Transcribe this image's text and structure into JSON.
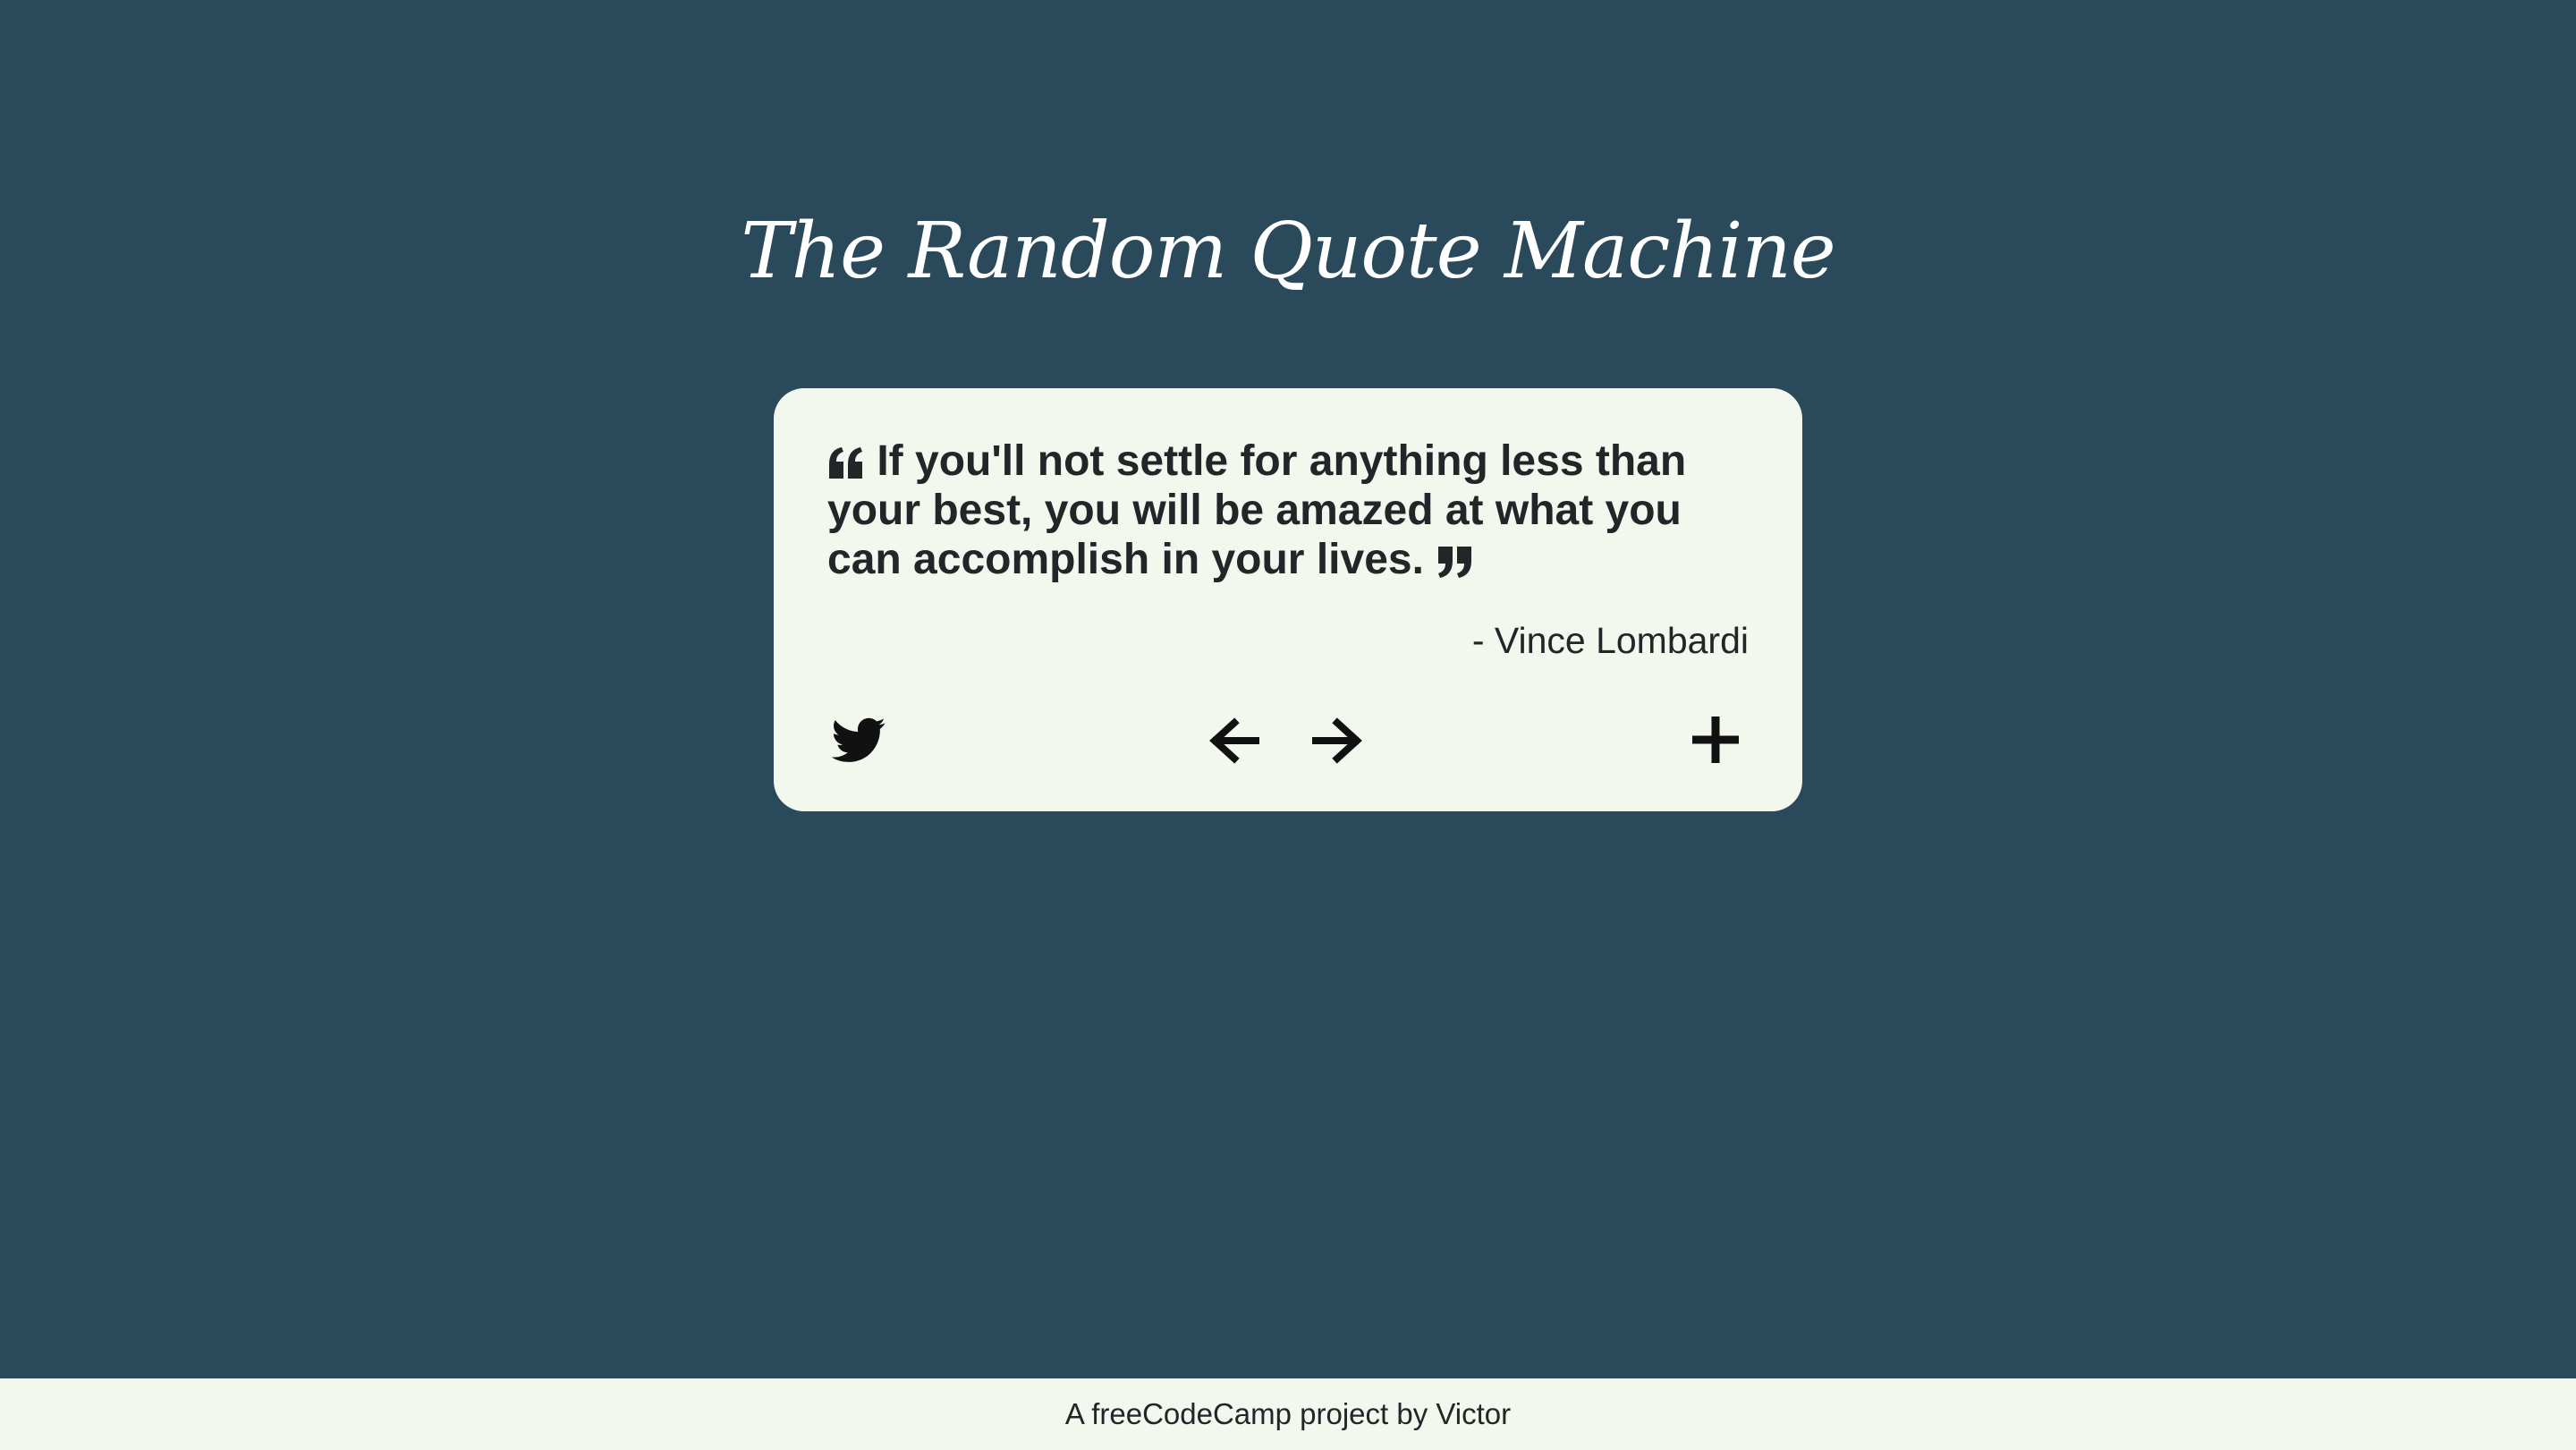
{
  "app": {
    "title": "The Random Quote Machine"
  },
  "quote": {
    "text": "If you'll not settle for anything less than your best, you will be amazed at what you can accomplish in your lives.",
    "author": "- Vince Lombardi"
  },
  "controls": {
    "tweet_icon": "twitter-icon",
    "prev_icon": "arrow-left-icon",
    "next_icon": "arrow-right-icon",
    "new_icon": "plus-icon"
  },
  "footer": {
    "text": "A freeCodeCamp project by Victor"
  },
  "colors": {
    "background": "#2a4a5c",
    "card": "#f2f8ee",
    "text": "#222629",
    "title": "#ffffff"
  }
}
